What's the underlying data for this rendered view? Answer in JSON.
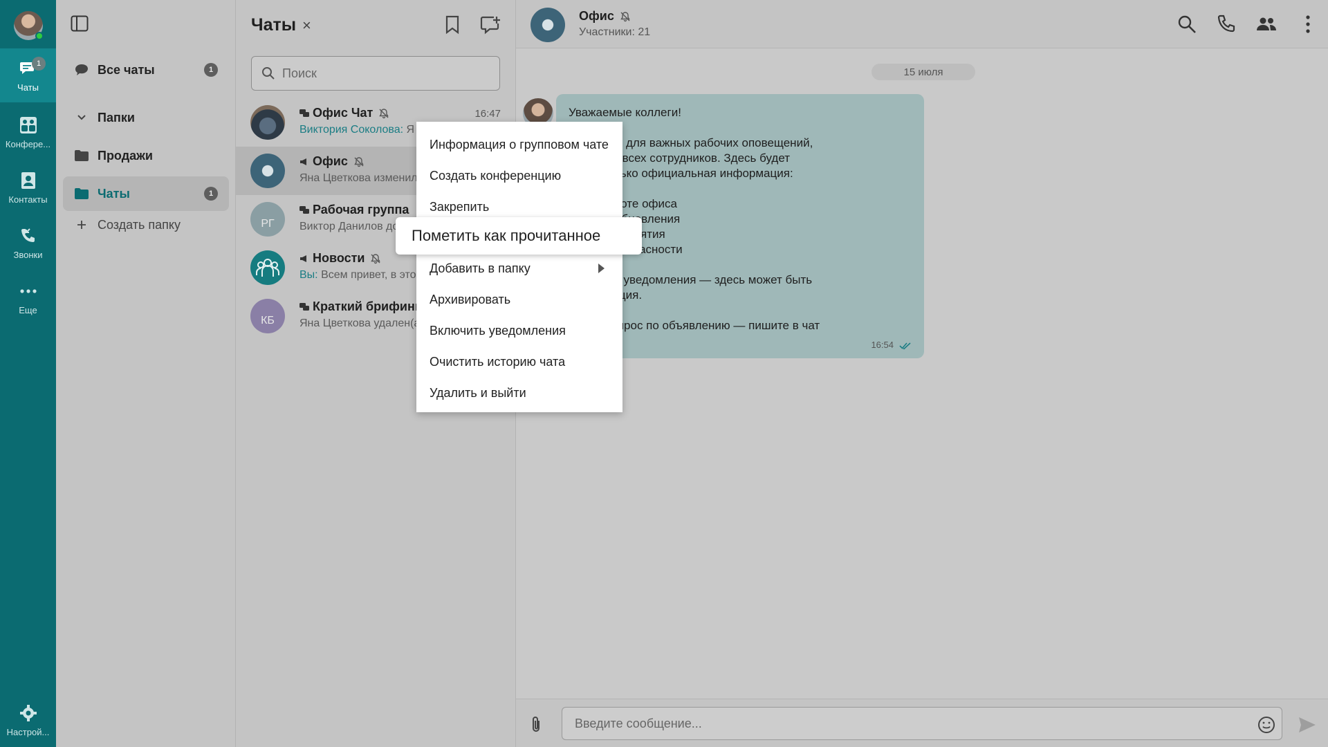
{
  "rail": {
    "items": [
      {
        "label": "Чаты",
        "badge": "1"
      },
      {
        "label": "Конфере..."
      },
      {
        "label": "Контакты"
      },
      {
        "label": "Звонки"
      },
      {
        "label": "Еще"
      }
    ],
    "settings_label": "Настрой..."
  },
  "folders": {
    "all_chats": {
      "label": "Все чаты",
      "badge": "1"
    },
    "folders_header": "Папки",
    "items": [
      {
        "label": "Продажи"
      },
      {
        "label": "Чаты",
        "badge": "1"
      }
    ],
    "create_folder": "Создать папку"
  },
  "chatlist": {
    "title": "Чаты",
    "close_glyph": "×",
    "search_placeholder": "Поиск",
    "chats": [
      {
        "name": "Офис Чат",
        "who": "Виктория Соколова:",
        "preview": " Я",
        "time": "16:47",
        "muted": true
      },
      {
        "name": "Офис",
        "who": "",
        "preview": "Яна Цветкова изменил",
        "time": "",
        "muted": true
      },
      {
        "name": "Рабочая группа",
        "who": "",
        "preview": "Виктор Данилов до",
        "time": "",
        "initials": "РГ"
      },
      {
        "name": "Новости",
        "who": "Вы:",
        "preview": " Всем привет, в это",
        "time": "",
        "muted": true
      },
      {
        "name": "Краткий брифинг",
        "who": "",
        "preview": "Яна Цветкова удален(а",
        "time": "",
        "initials": "КБ"
      }
    ]
  },
  "conversation": {
    "title": "Офис",
    "subtitle": "Участники: 21",
    "date_chip": "15 июля",
    "message": {
      "text": "Уважаемые коллеги!\n\n      ал создан для важных рабочих оповещений,\n       касаются всех сотрудников. Здесь будет\n       аться только официальная информация:\n\n       ния в работе офиса\n       тем или обновления\n       ные мероприятия\n       ия для безопасности\n\n       ключайте уведомления — здесь может быть\n       информация.\n\n       с есть вопрос по объявлению — пишите в чат\n       ат».",
      "time": "16:54"
    },
    "composer_placeholder": "Введите сообщение..."
  },
  "context_menu": {
    "items": [
      {
        "label": "Информация о групповом чате"
      },
      {
        "label": "Создать конференцию"
      },
      {
        "label": "Закрепить"
      },
      {
        "label": "Пометить как прочитанное"
      },
      {
        "label": "Добавить в папку",
        "submenu": true
      },
      {
        "label": "Архивировать"
      },
      {
        "label": "Включить уведомления"
      },
      {
        "label": "Очистить историю чата"
      },
      {
        "label": "Удалить и выйти"
      }
    ],
    "hovered": "Пометить как прочитанное"
  },
  "colors": {
    "rail": "#0b6b71",
    "accent": "#1b7d84",
    "bubble": "#9fb8b8"
  }
}
